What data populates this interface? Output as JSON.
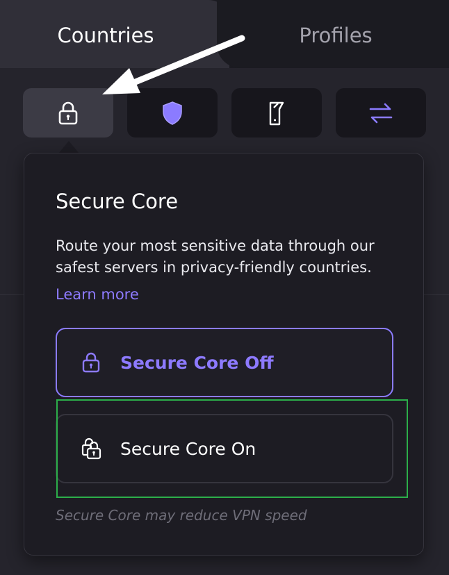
{
  "tabs": {
    "countries_label": "Countries",
    "profiles_label": "Profiles",
    "active": "Countries"
  },
  "feature_buttons": [
    {
      "icon": "lock-icon",
      "active": true
    },
    {
      "icon": "shield-icon",
      "active": false
    },
    {
      "icon": "p2p-icon",
      "active": false
    },
    {
      "icon": "swap-arrows-icon",
      "active": false
    }
  ],
  "popover": {
    "title": "Secure Core",
    "description": "Route your most sensitive data through our safest servers in privacy-friendly countries.",
    "learn_more": "Learn more",
    "options": {
      "off_label": "Secure Core Off",
      "on_label": "Secure Core On",
      "selected": "Secure Core Off"
    },
    "note": "Secure Core may reduce VPN speed"
  },
  "colors": {
    "accent": "#8d7aff",
    "background": "#25242c",
    "popover_bg": "#1d1c23",
    "highlight": "#2cae4a"
  }
}
